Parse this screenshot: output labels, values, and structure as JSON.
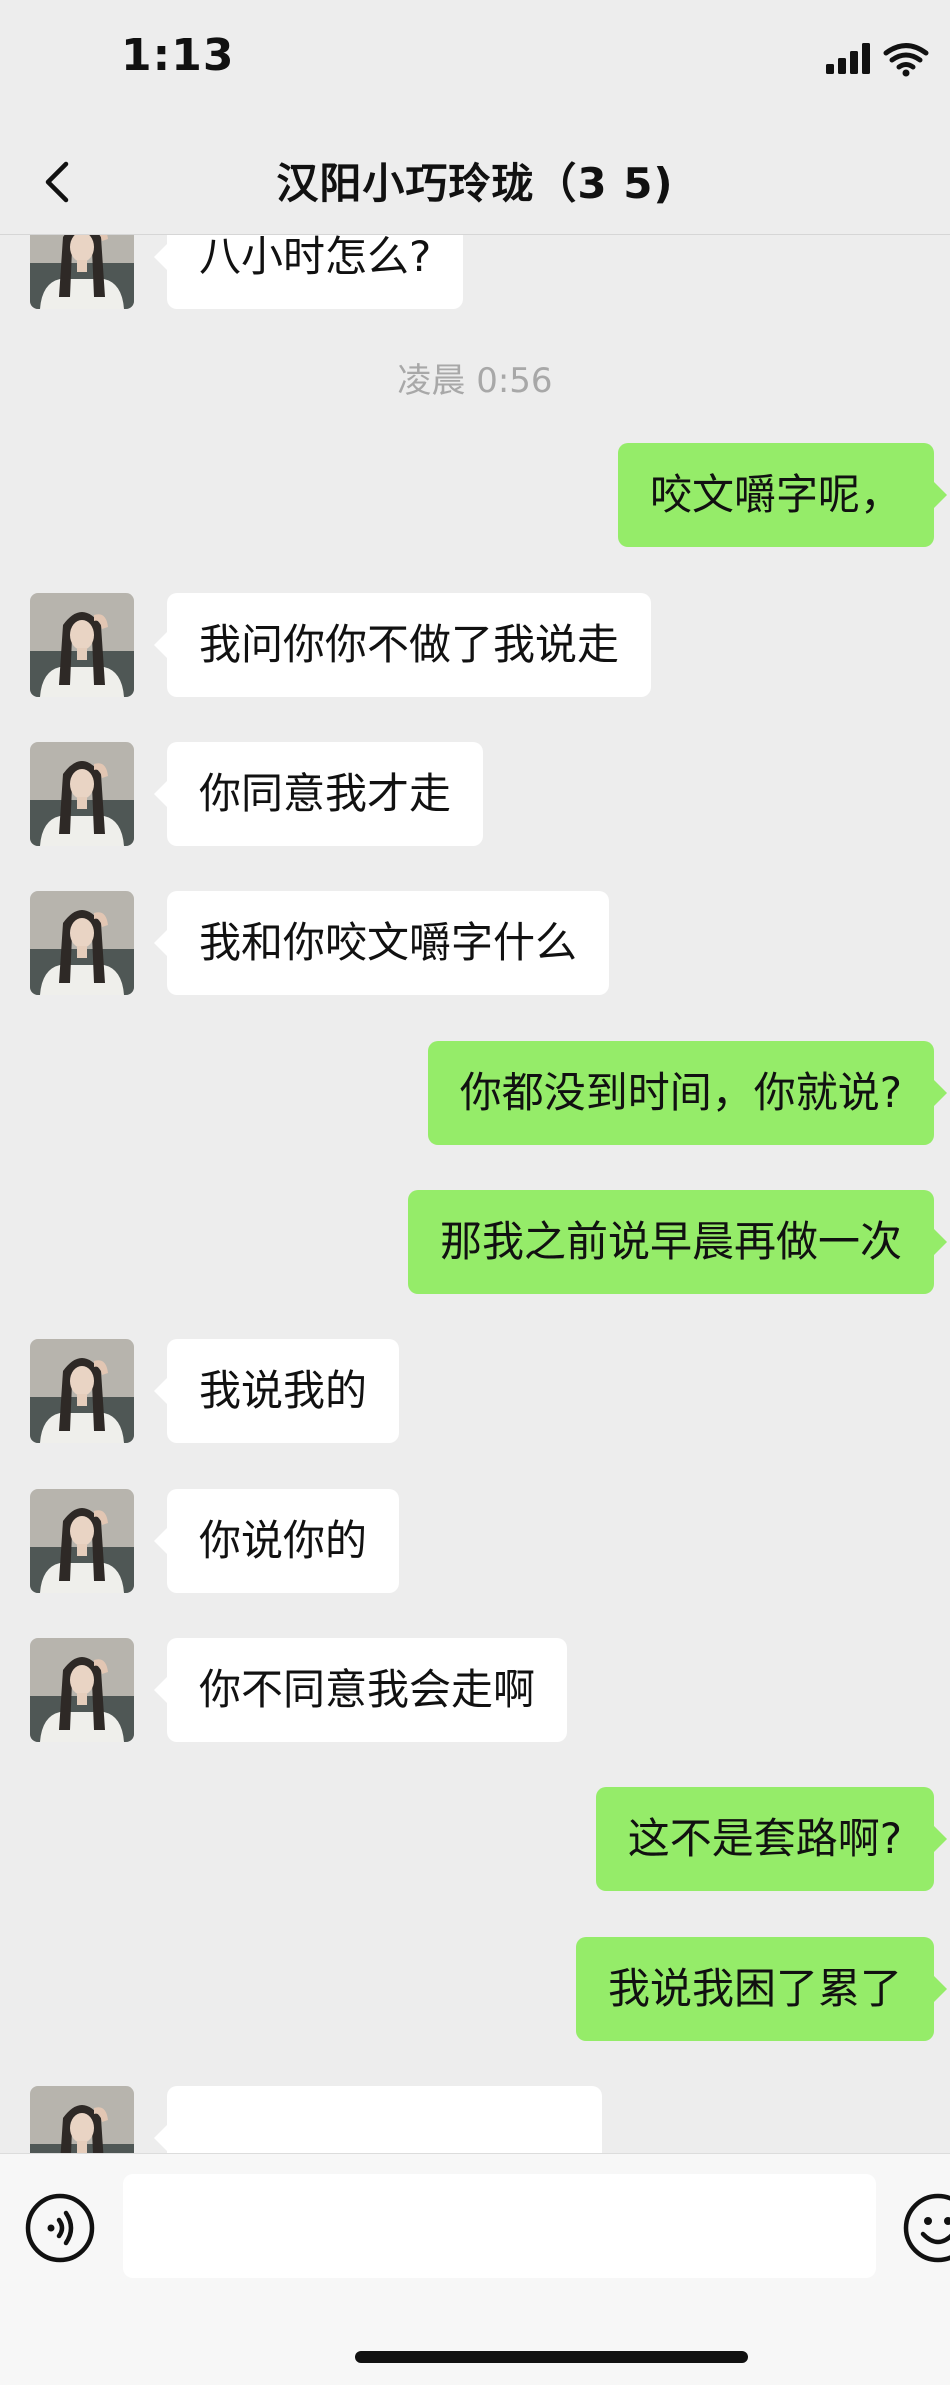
{
  "status_bar": {
    "time": "1:13"
  },
  "header": {
    "title": "汉阳小巧玲珑（3  5)"
  },
  "chat": {
    "timestamp": "凌晨 0:56",
    "messages": [
      {
        "dir": "in",
        "text": "八小时怎么?"
      },
      {
        "dir": "out",
        "text": "咬文嚼字呢，"
      },
      {
        "dir": "in",
        "text": "我问你你不做了我说走"
      },
      {
        "dir": "in",
        "text": "你同意我才走"
      },
      {
        "dir": "in",
        "text": "我和你咬文嚼字什么"
      },
      {
        "dir": "out",
        "text": "你都没到时间，你就说?"
      },
      {
        "dir": "out",
        "text": "那我之前说早晨再做一次"
      },
      {
        "dir": "in",
        "text": "我说我的"
      },
      {
        "dir": "in",
        "text": "你说你的"
      },
      {
        "dir": "in",
        "text": "你不同意我会走啊"
      },
      {
        "dir": "out",
        "text": "这不是套路啊?"
      },
      {
        "dir": "out",
        "text": "我说我困了累了"
      },
      {
        "dir": "in",
        "text": ""
      }
    ]
  },
  "input": {
    "value": "",
    "placeholder": ""
  },
  "colors": {
    "incoming_bubble": "#ffffff",
    "outgoing_bubble": "#95ec69",
    "background": "#ededed"
  }
}
